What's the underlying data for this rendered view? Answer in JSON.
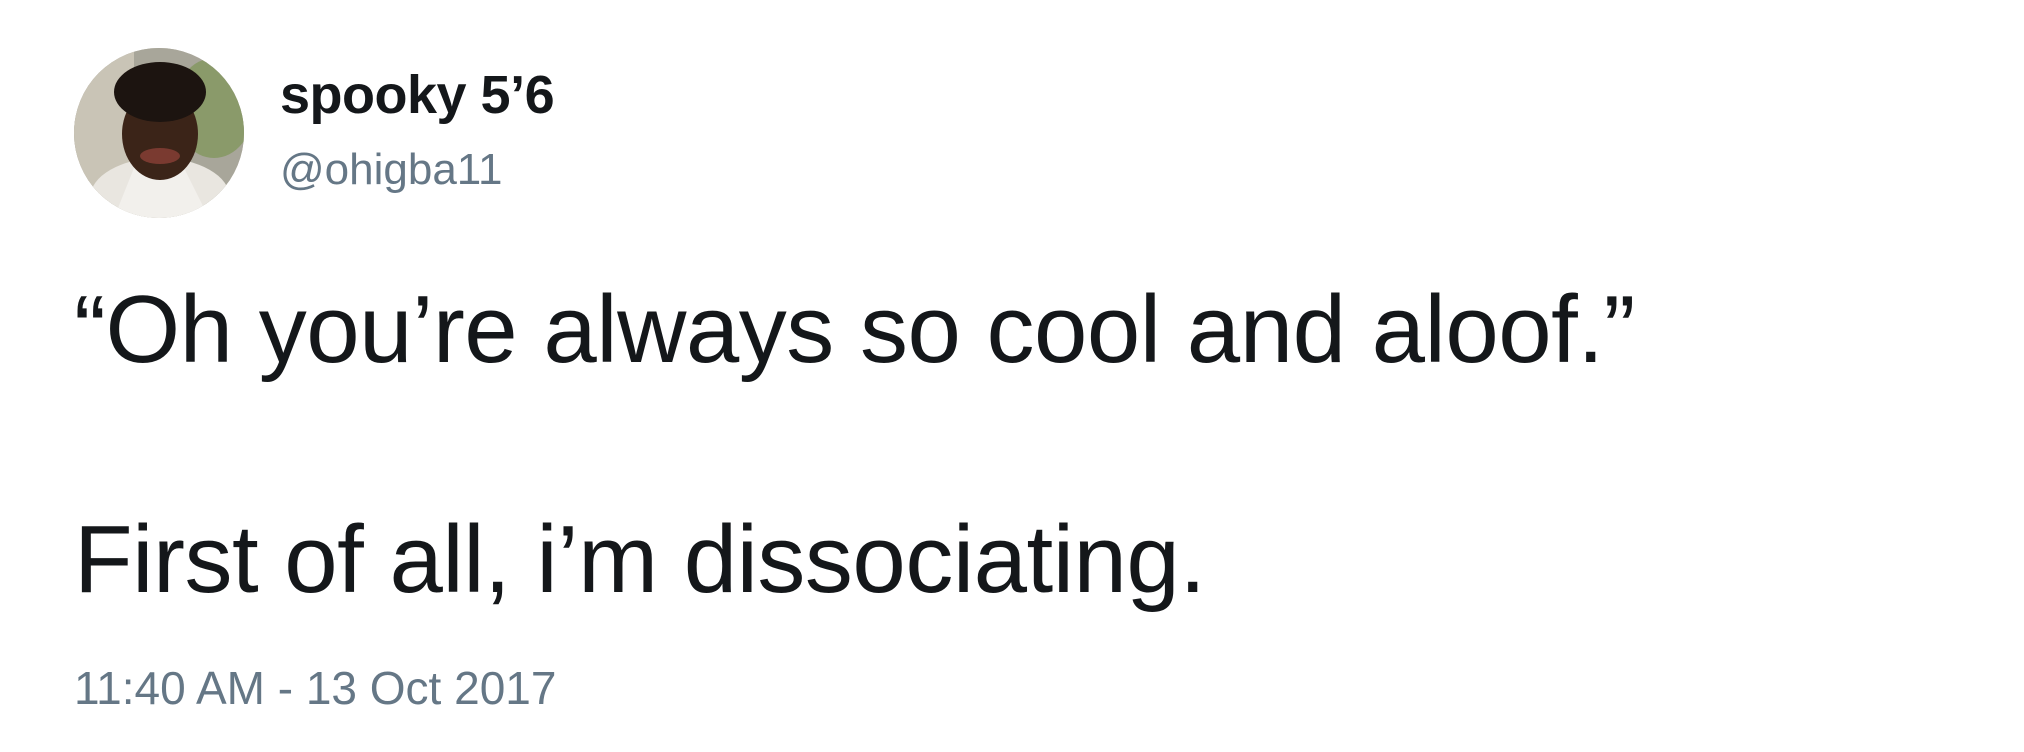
{
  "tweet": {
    "avatar_icon": "profile-photo-avatar",
    "display_name": "spooky 5’6",
    "handle": "@ohigba11",
    "text_lines": [
      "“Oh you’re always so cool and aloof.”",
      "First of all, i’m dissociating."
    ],
    "timestamp": "11:40 AM - 13 Oct 2017"
  },
  "colors": {
    "text_primary": "#14171a",
    "text_secondary": "#657786",
    "background": "#ffffff"
  }
}
